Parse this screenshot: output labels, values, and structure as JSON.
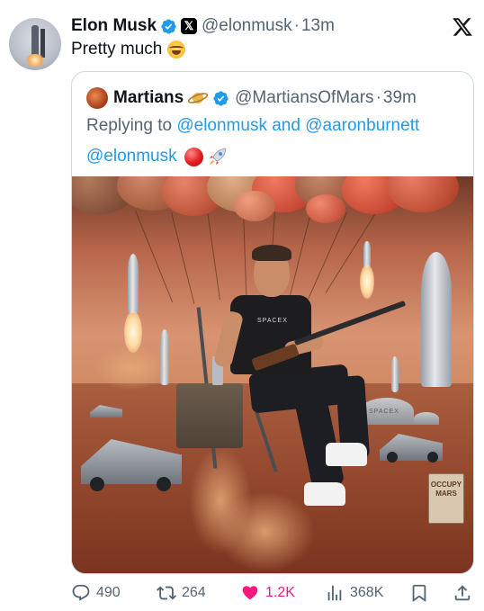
{
  "tweet": {
    "author_name": "Elon Musk",
    "author_handle": "@elonmusk",
    "separator": "·",
    "time": "13m",
    "text": "Pretty much",
    "text_emoji": "laughing-with-tears-emoji"
  },
  "quoted": {
    "author_name": "Martians",
    "author_emoji": "ringed-planet-emoji",
    "author_handle": "@MartiansOfMars",
    "separator": "·",
    "time": "39m",
    "replying_prefix": "Replying to ",
    "replying_user1": "@elonmusk",
    "replying_and": " and ",
    "replying_user2": "@aaronburnett",
    "mention": "@elonmusk",
    "mention_emojis": [
      "red-circle-emoji",
      "rocket-emoji"
    ],
    "media": {
      "shirt_text": "SPACEX",
      "dome_text": "SPACEX",
      "sign_line1": "OCCUPY",
      "sign_line2": "MARS"
    }
  },
  "actions": {
    "replies": "490",
    "reposts": "264",
    "likes": "1.2K",
    "views": "368K"
  },
  "colors": {
    "link": "#1d9bf0",
    "secondary_text": "#536471",
    "like": "#f91880",
    "border": "#cfd9de",
    "verified": "#1d9bf0"
  }
}
